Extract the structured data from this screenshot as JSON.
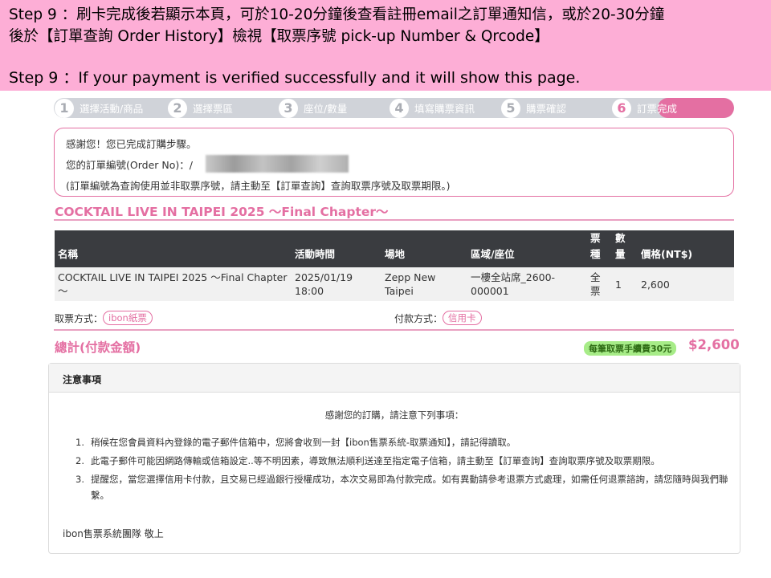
{
  "banner": {
    "line1": "Step 9 ：刷卡完成後若顯示本頁，可於10-20分鐘後查看註冊email之訂單通知信，或於20-30分鐘",
    "line2": "後於【訂單查詢 Order History】檢視【取票序號 pick-up Number & Qrcode】",
    "line3": "Step 9 ：If your payment is verified successfully and it will show this page."
  },
  "steps": [
    {
      "num": "1",
      "label": "選擇活動/商品"
    },
    {
      "num": "2",
      "label": "選擇票區"
    },
    {
      "num": "3",
      "label": "座位/數量"
    },
    {
      "num": "4",
      "label": "填寫購票資訊"
    },
    {
      "num": "5",
      "label": "購票確認"
    },
    {
      "num": "6",
      "label": "訂票完成"
    }
  ],
  "thanks": {
    "line1": "感謝您！您已完成訂購步驟。",
    "line2": "您的訂單編號(Order  No)：/",
    "line3": "(訂單編號為查詢使用並非取票序號，請主動至【訂單查詢】查詢取票序號及取票期限。)"
  },
  "event_title": "COCKTAIL LIVE IN TAIPEI 2025 ～Final Chapter～",
  "table": {
    "headers": {
      "name": "名稱",
      "time": "活動時間",
      "venue": "場地",
      "area": "區域/座位",
      "ticket_type": "票種",
      "quantity": "數量",
      "price": "價格(NT$)"
    },
    "row": {
      "name": "COCKTAIL LIVE IN TAIPEI 2025 ～Final Chapter～",
      "time_date": "2025/01/19",
      "time_clock": "18:00",
      "venue_1": "Zepp New",
      "venue_2": "Taipei",
      "area_1": "一樓全站席_2600-",
      "area_2": "000001",
      "ticket_type": "全票",
      "quantity": "1",
      "price": "2,600"
    }
  },
  "methods": {
    "pickup_label": "取票方式：",
    "pickup_value": "ibon紙票",
    "payment_label": "付款方式：",
    "payment_value": "信用卡"
  },
  "total": {
    "label": "總計(付款金額)",
    "fee_badge": "每筆取票手續費30元",
    "amount": "$2,600"
  },
  "notice": {
    "heading": "注意事項",
    "intro": "感謝您的訂購，請注意下列事項：",
    "items": [
      {
        "num": "1.",
        "text": "稍候在您會員資料內登錄的電子郵件信箱中，您將會收到一封【ibon售票系統-取票通知】，請記得讀取。"
      },
      {
        "num": "2.",
        "text": "此電子郵件可能因網路傳輸或信箱設定..等不明因素，導致無法順利送達至指定電子信箱，請主動至【訂單查詢】查詢取票序號及取票期限。"
      },
      {
        "num": "3.",
        "text": "提醒您，當您選擇信用卡付款，且交易已經過銀行授權成功，本次交易即為付款完成。如有異動請參考退票方式處理，如需任何退票諮詢，請您隨時與我們聯繫。"
      }
    ],
    "signature": "ibon售票系統團隊  敬上"
  },
  "colors": {
    "banner": "#fdaed6",
    "accent": "#e46fa2",
    "steps_bg": "#d0d3d9",
    "table_header": "#3a3c40",
    "fee_badge": "#a7ec88"
  },
  "current_step": 6
}
